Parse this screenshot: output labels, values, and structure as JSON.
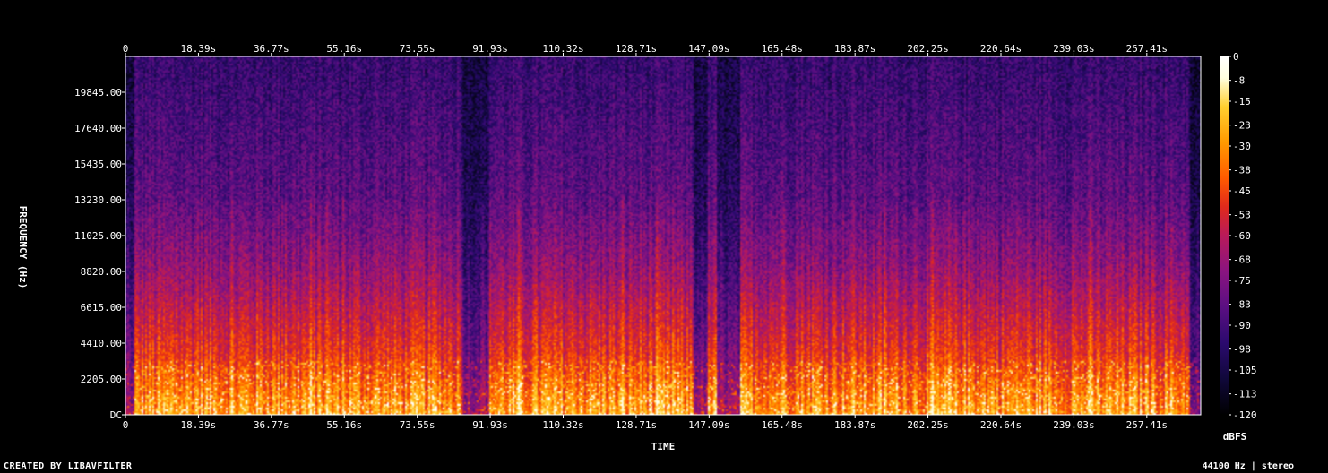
{
  "chart_data": {
    "type": "heatmap",
    "xlabel": "TIME",
    "ylabel": "FREQUENCY (Hz)",
    "x_ticks": [
      "0",
      "18.39s",
      "36.77s",
      "55.16s",
      "73.55s",
      "91.93s",
      "110.32s",
      "128.71s",
      "147.09s",
      "165.48s",
      "183.87s",
      "202.25s",
      "220.64s",
      "239.03s",
      "257.41s"
    ],
    "x_tick_values": [
      0,
      18.39,
      36.77,
      55.16,
      73.55,
      91.93,
      110.32,
      128.71,
      147.09,
      165.48,
      183.87,
      202.25,
      220.64,
      239.03,
      257.41
    ],
    "xlim": [
      0,
      271
    ],
    "y_ticks": [
      "DC",
      "2205.00",
      "4410.00",
      "6615.00",
      "8820.00",
      "11025.00",
      "13230.00",
      "15435.00",
      "17640.00",
      "19845.00"
    ],
    "y_tick_values": [
      0,
      2205,
      4410,
      6615,
      8820,
      11025,
      13230,
      15435,
      17640,
      19845
    ],
    "ylim": [
      0,
      22050
    ],
    "colorbar": {
      "label": "dBFS",
      "ticks": [
        "0",
        "-8",
        "-15",
        "-23",
        "-30",
        "-38",
        "-45",
        "-53",
        "-60",
        "-68",
        "-75",
        "-83",
        "-90",
        "-98",
        "-105",
        "-113",
        "-120"
      ],
      "tick_values": [
        0,
        -8,
        -15,
        -23,
        -30,
        -38,
        -45,
        -53,
        -60,
        -68,
        -75,
        -83,
        -90,
        -98,
        -105,
        -113,
        -120
      ],
      "range": [
        -120,
        0
      ]
    },
    "quiet_segments_s": [
      [
        85,
        91.5
      ],
      [
        143,
        147
      ],
      [
        149,
        155
      ]
    ],
    "colormap": [
      "#000000",
      "#10083a",
      "#2b0a6e",
      "#5a0f82",
      "#8a1480",
      "#b81a5a",
      "#e02a1c",
      "#ff5a00",
      "#ff9a00",
      "#ffd030",
      "#ffffe0",
      "#ffffff"
    ]
  },
  "footer": {
    "credit": "CREATED BY LIBAVFILTER",
    "format": "44100 Hz | stereo"
  }
}
